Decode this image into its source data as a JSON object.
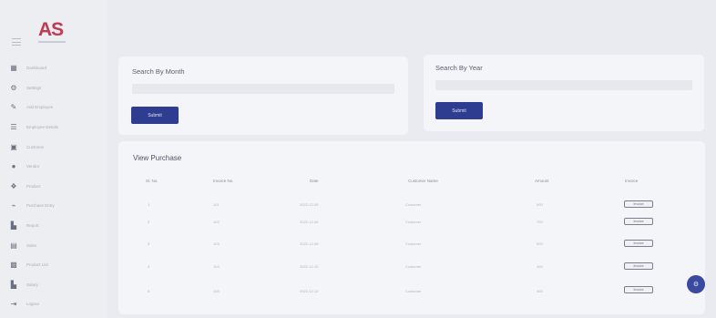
{
  "brand": {
    "logo": "AS"
  },
  "sidebar": {
    "items": [
      {
        "icon": "dashboard-icon",
        "label": "Dashboard"
      },
      {
        "icon": "settings-icon",
        "label": "Settings"
      },
      {
        "icon": "pencil-icon",
        "label": "Add Employee"
      },
      {
        "icon": "list-icon",
        "label": "Employee Details"
      },
      {
        "icon": "customer-icon",
        "label": "Customer"
      },
      {
        "icon": "user-icon",
        "label": "Vendor"
      },
      {
        "icon": "product-icon",
        "label": "Product"
      },
      {
        "icon": "purchase-icon",
        "label": "Purchase Entry"
      },
      {
        "icon": "report-icon",
        "label": "Report"
      },
      {
        "icon": "sales-icon",
        "label": "Sales"
      },
      {
        "icon": "box-icon",
        "label": "Product List"
      },
      {
        "icon": "chart-icon",
        "label": "Salary"
      },
      {
        "icon": "logout-icon",
        "label": "Logout"
      }
    ]
  },
  "search_month": {
    "title": "Search By Month",
    "submit_label": "Submit"
  },
  "search_year": {
    "title": "Search By Year",
    "submit_label": "Submit"
  },
  "purchase_table": {
    "title": "View Purchase",
    "columns": [
      "Sl. No.",
      "Invoice No.",
      "Date",
      "Customer Name",
      "Amount",
      "Invoice"
    ],
    "rows": [
      {
        "sl": "1",
        "invoice": "101",
        "date": "2022-12-05",
        "customer": "Customer",
        "amount": "500",
        "action": "Invoice"
      },
      {
        "sl": "2",
        "invoice": "102",
        "date": "2022-12-06",
        "customer": "Customer",
        "amount": "700",
        "action": "Invoice"
      },
      {
        "sl": "3",
        "invoice": "103",
        "date": "2022-12-08",
        "customer": "Customer",
        "amount": "900",
        "action": "Invoice"
      },
      {
        "sl": "4",
        "invoice": "104",
        "date": "2022-12-10",
        "customer": "Customer",
        "amount": "400",
        "action": "Invoice"
      },
      {
        "sl": "5",
        "invoice": "105",
        "date": "2022-12-12",
        "customer": "Customer",
        "amount": "300",
        "action": "Invoice"
      }
    ]
  },
  "fab": {
    "icon": "gear-icon"
  }
}
